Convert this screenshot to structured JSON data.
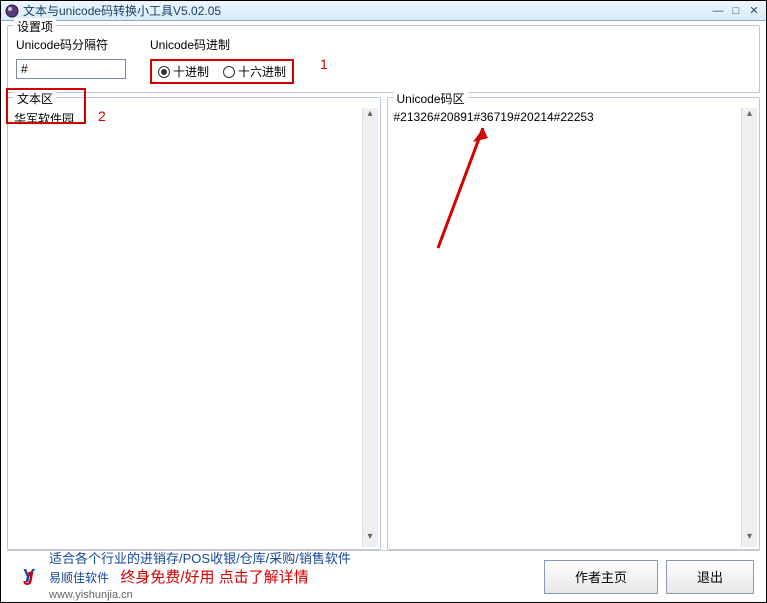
{
  "titlebar": {
    "title": "文本与unicode码转换小工具V5.02.05"
  },
  "settings": {
    "legend": "设置项",
    "separator_label": "Unicode码分隔符",
    "separator_value": "#",
    "radix_label": "Unicode码进制",
    "radio_dec": "十进制",
    "radio_hex": "十六进制"
  },
  "panes": {
    "text_legend": "文本区",
    "text_value": "华军软件园",
    "code_legend": "Unicode码区",
    "code_value": "#21326#20891#36719#20214#22253"
  },
  "annotations": {
    "one": "1",
    "two": "2"
  },
  "footer": {
    "ad_line1": "适合各个行业的进销存/POS收银/仓库/采购/销售软件",
    "ad_brand": "易顺佳软件",
    "ad_slogan": "终身免费/好用 点击了解详情",
    "ad_url": "www.yishunjia.cn",
    "btn_author": "作者主页",
    "btn_exit": "退出"
  }
}
